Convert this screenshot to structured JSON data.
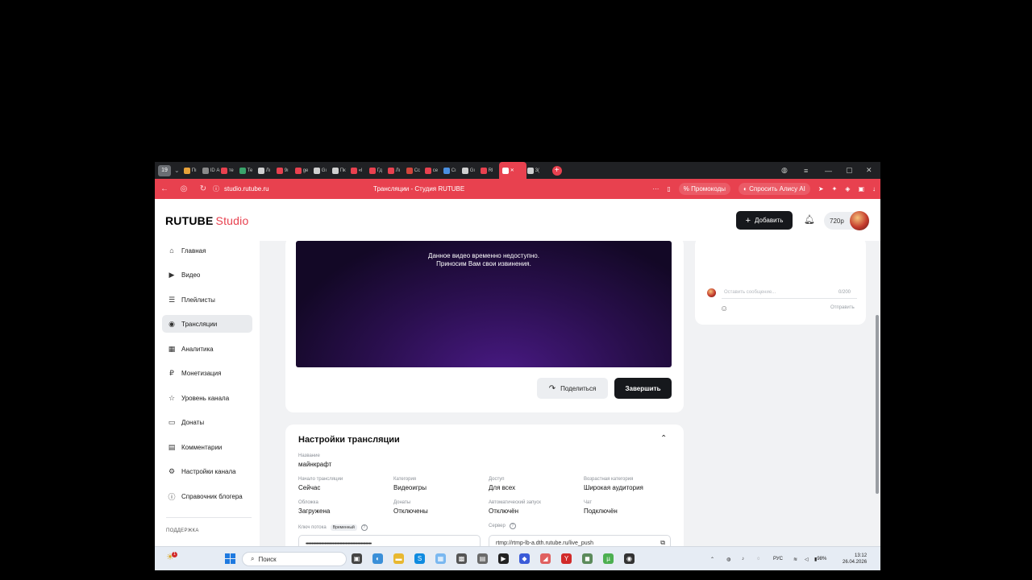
{
  "browser": {
    "tab_count": "19",
    "tabs": [
      {
        "label": "Пı",
        "color": "#e8a23a"
      },
      {
        "label": "ID Аı",
        "color": "#8a8a8a"
      },
      {
        "label": "те",
        "color": "#e8414f"
      },
      {
        "label": "Те",
        "color": "#3aa36b"
      },
      {
        "label": "Лı",
        "color": "#cfcfcf"
      },
      {
        "label": "9ı",
        "color": "#e8414f"
      },
      {
        "label": "ge",
        "color": "#e8414f"
      },
      {
        "label": "Gı",
        "color": "#cfcfcf"
      },
      {
        "label": "Пк",
        "color": "#cfcfcf"
      },
      {
        "label": "«l",
        "color": "#e8414f"
      },
      {
        "label": "Гд",
        "color": "#e8414f"
      },
      {
        "label": "Лı",
        "color": "#e8414f"
      },
      {
        "label": "Сс",
        "color": "#d1453b"
      },
      {
        "label": "се",
        "color": "#e8414f"
      },
      {
        "label": "Сı",
        "color": "#4a8fe0"
      },
      {
        "label": "Gı",
        "color": "#cfcfcf"
      },
      {
        "label": "Rl",
        "color": "#e8414f"
      }
    ],
    "active_tab_label": "",
    "last_tab_label": "3(",
    "url": "studio.rutube.ru",
    "page_title": "Трансляции - Студия RUTUBE",
    "promo_label": "Промокоды",
    "alice_label": "Спросить Алису AI",
    "accent_color": "#e8414f"
  },
  "header": {
    "logo_main": "RUTUBE",
    "logo_studio": "Studio",
    "add_button": "Добавить",
    "balance": "720р"
  },
  "sidebar": {
    "items": [
      {
        "label": "Главная",
        "icon": "home-icon",
        "glyph": "⌂"
      },
      {
        "label": "Видео",
        "icon": "video-icon",
        "glyph": "▶"
      },
      {
        "label": "Плейлисты",
        "icon": "playlist-icon",
        "glyph": "☰"
      },
      {
        "label": "Трансляции",
        "icon": "broadcast-icon",
        "glyph": "◉"
      },
      {
        "label": "Аналитика",
        "icon": "analytics-icon",
        "glyph": "▦"
      },
      {
        "label": "Монетизация",
        "icon": "ruble-icon",
        "glyph": "₽"
      },
      {
        "label": "Уровень канала",
        "icon": "star-icon",
        "glyph": "☆"
      },
      {
        "label": "Донаты",
        "icon": "wallet-icon",
        "glyph": "▭"
      },
      {
        "label": "Комментарии",
        "icon": "comment-icon",
        "glyph": "▤"
      },
      {
        "label": "Настройки канала",
        "icon": "gear-icon",
        "glyph": "⚙"
      },
      {
        "label": "Справочник блогера",
        "icon": "info-icon",
        "glyph": "ⓘ"
      }
    ],
    "active_index": 3,
    "section_label": "ПОДДЕРЖКА"
  },
  "player": {
    "message_line1": "Данное видео временно недоступно.",
    "message_line2": "Приносим Вам свои извинения."
  },
  "actions": {
    "share": "Поделиться",
    "finish": "Завершить"
  },
  "settings": {
    "title": "Настройки трансляции",
    "name_label": "Название",
    "name_value": "майнкрафт",
    "fields": [
      {
        "label": "Начало трансляции",
        "value": "Сейчас"
      },
      {
        "label": "Категория",
        "value": "Видеоигры"
      },
      {
        "label": "Доступ",
        "value": "Для всех"
      },
      {
        "label": "Возрастная категория",
        "value": "Широкая аудитория"
      },
      {
        "label": "Обложка",
        "value": "Загружена"
      },
      {
        "label": "Донаты",
        "value": "Отключены"
      },
      {
        "label": "Автоматический запуск",
        "value": "Отключён"
      },
      {
        "label": "Чат",
        "value": "Подключён"
      }
    ],
    "stream_key_label": "Ключ потока",
    "stream_key_badge": "Временный",
    "stream_key_value": "••••••••••••••••••••••••••••••••••••••••••••••••••••••••",
    "server_label": "Сервер",
    "server_value": "rtmp://rtmp-lb-a.dth.rutube.ru/live_push"
  },
  "chat": {
    "placeholder": "Оставить сообщение...",
    "counter": "0/200",
    "send": "Отправить"
  },
  "taskbar": {
    "search_placeholder": "Поиск",
    "notif_count": "1",
    "lang": "РУС",
    "battery": "98%",
    "time": "13:12",
    "date": "26.04.2026"
  }
}
